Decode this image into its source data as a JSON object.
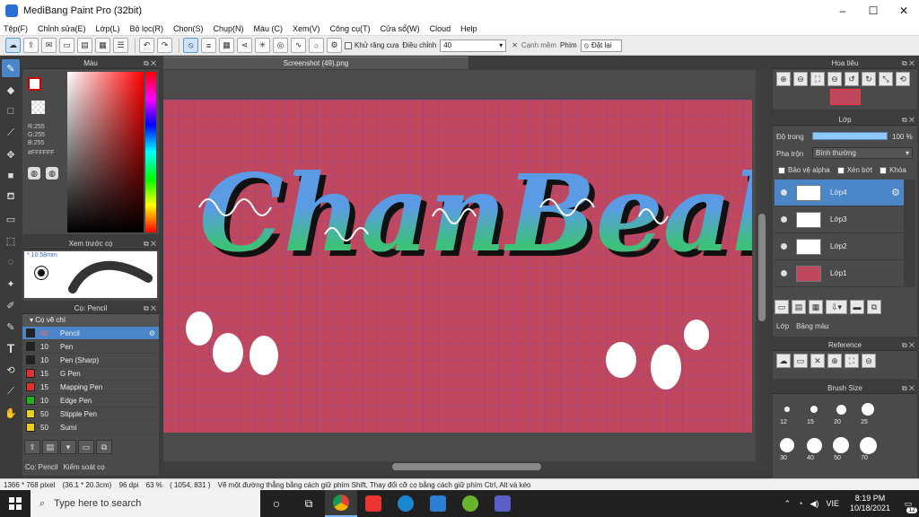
{
  "window": {
    "title": "MediBang Paint Pro (32bit)",
    "controls": [
      "–",
      "☐",
      "✕"
    ]
  },
  "menu": [
    "Tệp(F)",
    "Chỉnh sửa(E)",
    "Lớp(L)",
    "Bộ lọc(R)",
    "Chọn(S)",
    "Chụp(N)",
    "Màu (C)",
    "Xem(V)",
    "Công cụ(T)",
    "Cửa sổ(W)",
    "Cloud",
    "Help"
  ],
  "toolbar": {
    "antialias_label": "Khử răng cưa",
    "correction_label": "Điều chỉnh",
    "correction_value": "40",
    "sharp_label": "Cạnh mềm",
    "key_label": "Phím",
    "reset_label": "Đặt lại"
  },
  "color_panel": {
    "title": "Màu",
    "r": "R:255",
    "g": "G:255",
    "b": "B:255",
    "hex": "#FFFFFF",
    "main_color": "#ffffff",
    "sub_color": "#b3121d"
  },
  "brush_preview": {
    "title": "Xem trước cọ",
    "size": "10.58mm"
  },
  "brush_panel": {
    "title": "Cọ: Pencil",
    "group": "Cọ vẽ chì",
    "brushes": [
      {
        "size": "40",
        "name": "Pencil",
        "color": "#222222",
        "selected": true
      },
      {
        "size": "10",
        "name": "Pen",
        "color": "#222222",
        "selected": false
      },
      {
        "size": "10",
        "name": "Pen (Sharp)",
        "color": "#222222",
        "selected": false
      },
      {
        "size": "15",
        "name": "G Pen",
        "color": "#e03030",
        "selected": false
      },
      {
        "size": "15",
        "name": "Mapping Pen",
        "color": "#e03030",
        "selected": false
      },
      {
        "size": "10",
        "name": "Edge Pen",
        "color": "#20b020",
        "selected": false
      },
      {
        "size": "50",
        "name": "Stipple Pen",
        "color": "#e8d020",
        "selected": false
      },
      {
        "size": "50",
        "name": "Sumi",
        "color": "#e8d020",
        "selected": false
      }
    ],
    "tabs": [
      "Cọ: Pencil",
      "Kiểm soát cọ"
    ]
  },
  "document": {
    "tab": "Screenshot (49).png",
    "canvas_color": "#c0485e"
  },
  "navigator": {
    "title": "Hoa tiêu"
  },
  "layer_panel": {
    "title": "Lớp",
    "opacity_label": "Độ trong",
    "opacity_value": "100 %",
    "opacity_fraction": 1.0,
    "blend_label": "Pha trộn",
    "blend_value": "Bình thường",
    "protect_alpha": "Bảo vệ alpha",
    "clipping": "Xén bớt",
    "lock": "Khóa",
    "layers": [
      {
        "name": "Lớp4",
        "selected": true
      },
      {
        "name": "Lớp3",
        "selected": false
      },
      {
        "name": "Lớp2",
        "selected": false
      },
      {
        "name": "Lớp1",
        "selected": false
      }
    ],
    "tabs": [
      "Lớp",
      "Bảng màu"
    ]
  },
  "reference": {
    "title": "Reference"
  },
  "brush_size": {
    "title": "Brush Size",
    "sizes": [
      "12",
      "15",
      "20",
      "25",
      "30",
      "40",
      "50",
      "70"
    ]
  },
  "status": {
    "size": "1366 * 768 pixel",
    "cm": "(36.1 * 20.3cm)",
    "dpi": "96 dpi",
    "zoom": "63 %",
    "coords": "( 1054, 831 )",
    "hint": "Vẽ một đường thẳng bằng cách giữ phím Shift, Thay đổi cỡ cọ bằng cách giữ phím Ctrl, Alt và kéo"
  },
  "taskbar": {
    "search_placeholder": "Type here to search",
    "lang": "VIE",
    "time": "8:19 PM",
    "date": "10/18/2021",
    "notif_count": "12"
  }
}
